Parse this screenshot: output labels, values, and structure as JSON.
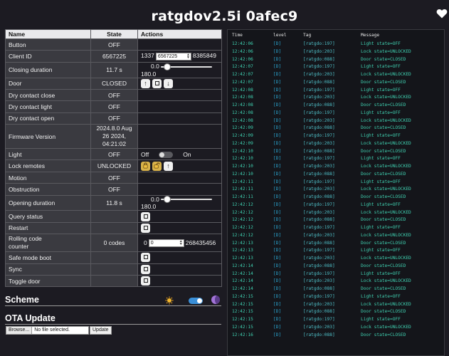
{
  "header": {
    "title": "ratgdov2.5i 0afec9"
  },
  "table": {
    "headers": [
      "Name",
      "State",
      "Actions"
    ],
    "rows": {
      "button": {
        "name": "Button",
        "state": "OFF"
      },
      "client_id": {
        "name": "Client ID",
        "state": "6567225",
        "min": "1337",
        "value": "6567225",
        "max": "8385849"
      },
      "closing_duration": {
        "name": "Closing duration",
        "state": "11.7 s",
        "min": "0.0",
        "max": "180.0",
        "level": 0.065
      },
      "door": {
        "name": "Door",
        "state": "CLOSED"
      },
      "dry_contact_close": {
        "name": "Dry contact close",
        "state": "OFF"
      },
      "dry_contact_light": {
        "name": "Dry contact light",
        "state": "OFF"
      },
      "dry_contact_open": {
        "name": "Dry contact open",
        "state": "OFF"
      },
      "firmware_version": {
        "name": "Firmware Version",
        "state_line1": "2024.8.0 Aug 26 2024,",
        "state_line2": "04:21:02"
      },
      "light": {
        "name": "Light",
        "state": "OFF",
        "off_label": "Off",
        "on_label": "On"
      },
      "lock_remotes": {
        "name": "Lock remotes",
        "state": "UNLOCKED"
      },
      "motion": {
        "name": "Motion",
        "state": "OFF"
      },
      "obstruction": {
        "name": "Obstruction",
        "state": "OFF"
      },
      "opening_duration": {
        "name": "Opening duration",
        "state": "11.8 s",
        "min": "0.0",
        "max": "180.0",
        "level": 0.066
      },
      "query_status": {
        "name": "Query status",
        "state": ""
      },
      "restart": {
        "name": "Restart",
        "state": ""
      },
      "rolling_code": {
        "name_line1": "Rolling code",
        "name_line2": "counter",
        "state": "0 codes",
        "min": "0",
        "value": "0",
        "max": "268435456"
      },
      "safe_mode_boot": {
        "name": "Safe mode boot",
        "state": ""
      },
      "sync": {
        "name": "Sync",
        "state": ""
      },
      "toggle_door": {
        "name": "Toggle door",
        "state": ""
      }
    }
  },
  "scheme": {
    "title": "Scheme",
    "dark_mode": true
  },
  "ota": {
    "title": "OTA Update",
    "browse_label": "Browse...",
    "file_status": "No file selected.",
    "update_label": "Update"
  },
  "log": {
    "headers": {
      "time": "Time",
      "level": "level",
      "tag": "Tag",
      "message": "Message"
    },
    "entries": [
      {
        "time": "12:42:06",
        "level": "[D]",
        "tag": "[ratgdo:197]",
        "message": "Light state=OFF"
      },
      {
        "time": "12:42:06",
        "level": "[D]",
        "tag": "[ratgdo:203]",
        "message": "Lock state=UNLOCKED"
      },
      {
        "time": "12:42:06",
        "level": "[D]",
        "tag": "[ratgdo:088]",
        "message": "Door state=CLOSED"
      },
      {
        "time": "12:42:07",
        "level": "[D]",
        "tag": "[ratgdo:197]",
        "message": "Light state=OFF"
      },
      {
        "time": "12:42:07",
        "level": "[D]",
        "tag": "[ratgdo:203]",
        "message": "Lock state=UNLOCKED"
      },
      {
        "time": "12:42:07",
        "level": "[D]",
        "tag": "[ratgdo:088]",
        "message": "Door state=CLOSED"
      },
      {
        "time": "12:42:08",
        "level": "[D]",
        "tag": "[ratgdo:197]",
        "message": "Light state=OFF"
      },
      {
        "time": "12:42:08",
        "level": "[D]",
        "tag": "[ratgdo:203]",
        "message": "Lock state=UNLOCKED"
      },
      {
        "time": "12:42:08",
        "level": "[D]",
        "tag": "[ratgdo:088]",
        "message": "Door state=CLOSED"
      },
      {
        "time": "12:42:08",
        "level": "[D]",
        "tag": "[ratgdo:197]",
        "message": "Light state=OFF"
      },
      {
        "time": "12:42:08",
        "level": "[D]",
        "tag": "[ratgdo:203]",
        "message": "Lock state=UNLOCKED"
      },
      {
        "time": "12:42:09",
        "level": "[D]",
        "tag": "[ratgdo:088]",
        "message": "Door state=CLOSED"
      },
      {
        "time": "12:42:09",
        "level": "[D]",
        "tag": "[ratgdo:197]",
        "message": "Light state=OFF"
      },
      {
        "time": "12:42:09",
        "level": "[D]",
        "tag": "[ratgdo:203]",
        "message": "Lock state=UNLOCKED"
      },
      {
        "time": "12:42:10",
        "level": "[D]",
        "tag": "[ratgdo:088]",
        "message": "Door state=CLOSED"
      },
      {
        "time": "12:42:10",
        "level": "[D]",
        "tag": "[ratgdo:197]",
        "message": "Light state=OFF"
      },
      {
        "time": "12:42:10",
        "level": "[D]",
        "tag": "[ratgdo:203]",
        "message": "Lock state=UNLOCKED"
      },
      {
        "time": "12:42:10",
        "level": "[D]",
        "tag": "[ratgdo:088]",
        "message": "Door state=CLOSED"
      },
      {
        "time": "12:42:11",
        "level": "[D]",
        "tag": "[ratgdo:197]",
        "message": "Light state=OFF"
      },
      {
        "time": "12:42:11",
        "level": "[D]",
        "tag": "[ratgdo:203]",
        "message": "Lock state=UNLOCKED"
      },
      {
        "time": "12:42:11",
        "level": "[D]",
        "tag": "[ratgdo:088]",
        "message": "Door state=CLOSED"
      },
      {
        "time": "12:42:12",
        "level": "[D]",
        "tag": "[ratgdo:197]",
        "message": "Light state=OFF"
      },
      {
        "time": "12:42:12",
        "level": "[D]",
        "tag": "[ratgdo:203]",
        "message": "Lock state=UNLOCKED"
      },
      {
        "time": "12:42:12",
        "level": "[D]",
        "tag": "[ratgdo:088]",
        "message": "Door state=CLOSED"
      },
      {
        "time": "12:42:12",
        "level": "[D]",
        "tag": "[ratgdo:197]",
        "message": "Light state=OFF"
      },
      {
        "time": "12:42:12",
        "level": "[D]",
        "tag": "[ratgdo:203]",
        "message": "Lock state=UNLOCKED"
      },
      {
        "time": "12:42:13",
        "level": "[D]",
        "tag": "[ratgdo:088]",
        "message": "Door state=CLOSED"
      },
      {
        "time": "12:42:13",
        "level": "[D]",
        "tag": "[ratgdo:197]",
        "message": "Light state=OFF"
      },
      {
        "time": "12:42:13",
        "level": "[D]",
        "tag": "[ratgdo:203]",
        "message": "Lock state=UNLOCKED"
      },
      {
        "time": "12:42:14",
        "level": "[D]",
        "tag": "[ratgdo:088]",
        "message": "Door state=CLOSED"
      },
      {
        "time": "12:42:14",
        "level": "[D]",
        "tag": "[ratgdo:197]",
        "message": "Light state=OFF"
      },
      {
        "time": "12:42:14",
        "level": "[D]",
        "tag": "[ratgdo:203]",
        "message": "Lock state=UNLOCKED"
      },
      {
        "time": "12:42:14",
        "level": "[D]",
        "tag": "[ratgdo:088]",
        "message": "Door state=CLOSED"
      },
      {
        "time": "12:42:15",
        "level": "[D]",
        "tag": "[ratgdo:197]",
        "message": "Light state=OFF"
      },
      {
        "time": "12:42:15",
        "level": "[D]",
        "tag": "[ratgdo:203]",
        "message": "Lock state=UNLOCKED"
      },
      {
        "time": "12:42:15",
        "level": "[D]",
        "tag": "[ratgdo:088]",
        "message": "Door state=CLOSED"
      },
      {
        "time": "12:42:15",
        "level": "[D]",
        "tag": "[ratgdo:197]",
        "message": "Light state=OFF"
      },
      {
        "time": "12:42:15",
        "level": "[D]",
        "tag": "[ratgdo:203]",
        "message": "Lock state=UNLOCKED"
      },
      {
        "time": "12:42:16",
        "level": "[D]",
        "tag": "[ratgdo:088]",
        "message": "Door state=CLOSED"
      }
    ]
  }
}
